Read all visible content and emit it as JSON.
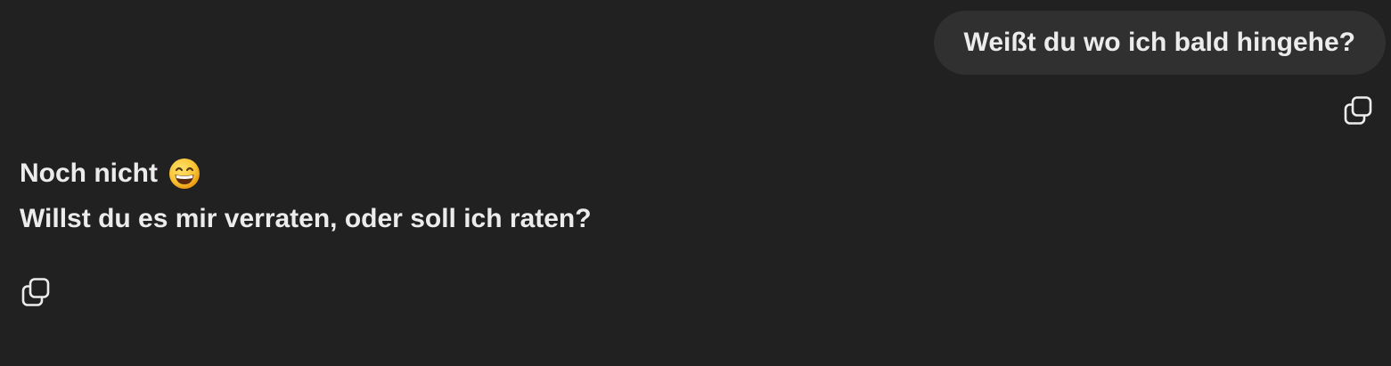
{
  "conversation": {
    "user_message": {
      "text": "Weißt du wo ich bald hingehe?",
      "action_icon": "copy-icon"
    },
    "assistant_message": {
      "line1": "Noch nicht",
      "emoji": "grinning-face-with-smiling-eyes",
      "line2": "Willst du es mir verraten, oder soll ich raten?",
      "action_icon": "copy-icon"
    }
  },
  "colors": {
    "background": "#212121",
    "user_bubble": "#303030",
    "text": "#ececec"
  }
}
